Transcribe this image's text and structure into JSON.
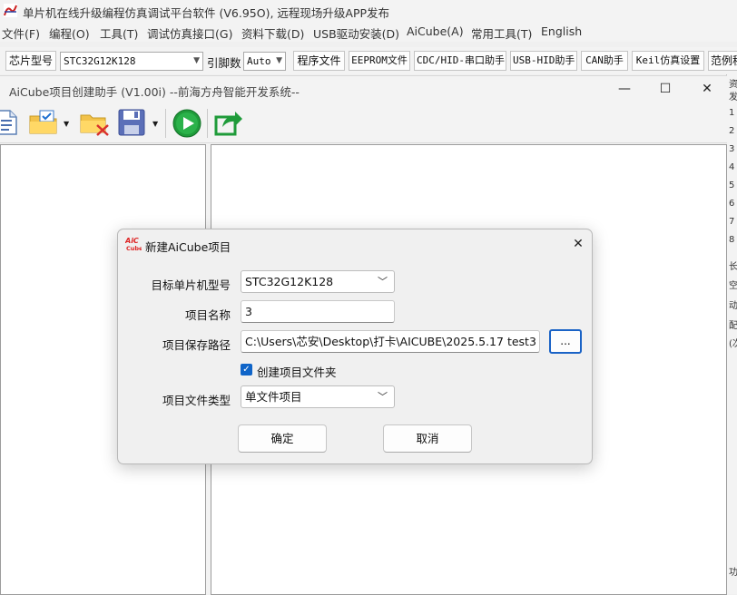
{
  "main_window": {
    "title": "单片机在线升级编程仿真调试平台软件 (V6.95O), 远程现场升级APP发布",
    "menu": [
      "文件(F)",
      "编程(O)",
      "工具(T)",
      "调试仿真接口(G)",
      "资料下载(D)",
      "USB驱动安装(D)",
      "AiCube(A)",
      "常用工具(T)",
      "English"
    ],
    "toolbar": {
      "chip_label": "芯片型号",
      "chip_value": "STC32G12K128",
      "pins_label": "引脚数",
      "pins_value": "Auto",
      "buttons": [
        "程序文件",
        "EEPROM文件",
        "CDC/HID-串口助手",
        "USB-HID助手",
        "CAN助手",
        "Keil仿真设置",
        "范例程"
      ]
    },
    "right_strip": [
      "资",
      "发",
      "1",
      "2",
      "3",
      "4",
      "5",
      "6",
      "7",
      "8",
      "长",
      "空",
      "动",
      "配",
      "(次",
      "功"
    ]
  },
  "aicube_window": {
    "title": "AiCube项目创建助手 (V1.00i) --前海方舟智能开发系统--",
    "controls": [
      "—",
      "☐",
      "✕"
    ]
  },
  "dialog": {
    "logo_text": "AiC\nCube",
    "title": "新建AiCube项目",
    "close": "✕",
    "mcu_label": "目标单片机型号",
    "mcu_value": "STC32G12K128",
    "name_label": "项目名称",
    "name_value": "3",
    "path_label": "项目保存路径",
    "path_value": "C:\\Users\\芯安\\Desktop\\打卡\\AICUBE\\2025.5.17 test3",
    "browse_label": "...",
    "create_folder_label": "创建项目文件夹",
    "create_folder_checked": true,
    "type_label": "项目文件类型",
    "type_value": "单文件项目",
    "ok_label": "确定",
    "cancel_label": "取消"
  },
  "colors": {
    "accent": "#1a63c6",
    "checkbox": "#0f64c8",
    "run_green": "#1f9b3a"
  }
}
